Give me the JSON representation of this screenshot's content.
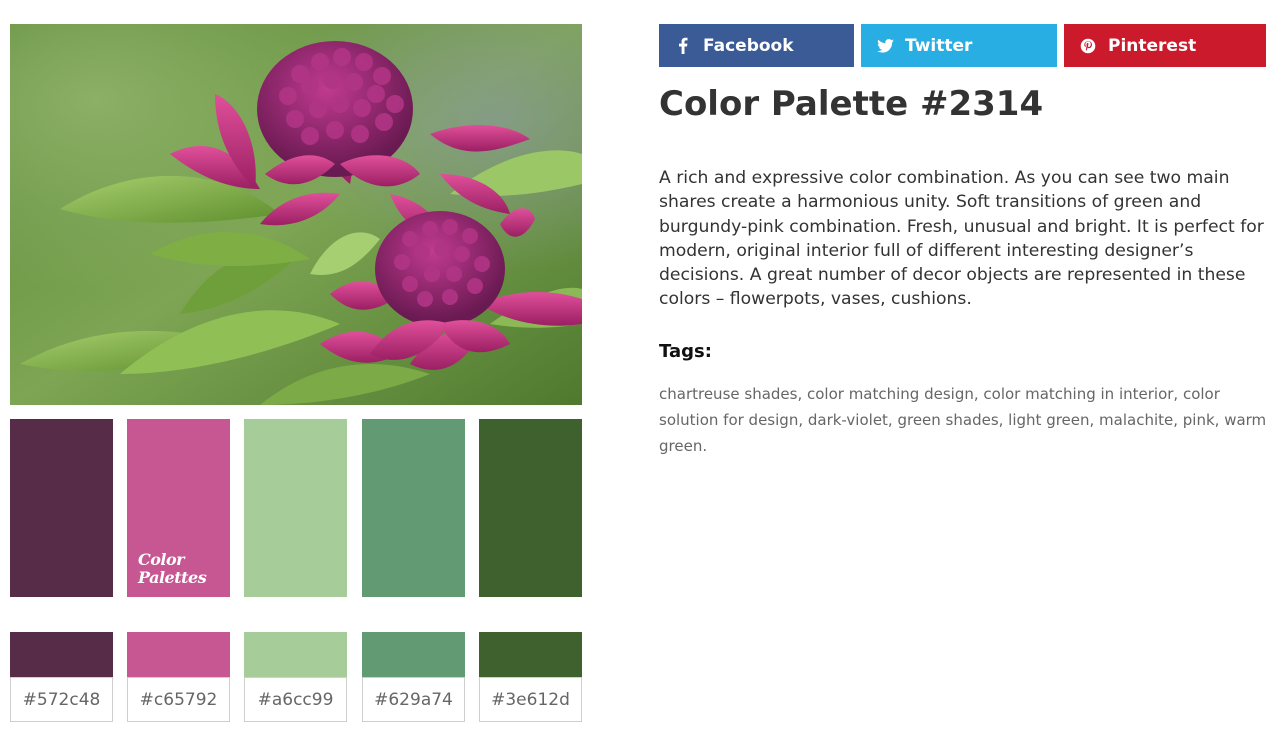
{
  "share": {
    "facebook": {
      "label": "Facebook",
      "color": "#3b5b97",
      "icon": "facebook-icon"
    },
    "twitter": {
      "label": "Twitter",
      "color": "#29aee3",
      "icon": "twitter-icon"
    },
    "pinterest": {
      "label": "Pinterest",
      "color": "#cb1a2c",
      "icon": "pinterest-icon"
    }
  },
  "page": {
    "title": "Color Palette #2314",
    "description": "A rich and expressive color combination. As you can see two main shares create a harmonious unity. Soft transitions of green and burgundy-pink combination. Fresh, unusual and bright. It is perfect for modern, original interior full of different interesting designer’s decisions. A great number of decor objects are represented in these colors – flowerpots, vases, cushions.",
    "tags_label": "Tags:",
    "tags": "chartreuse shades, color matching design, color matching in interior, color solution for design, dark-violet, green shades, light green, malachite, pink, warm green."
  },
  "palette": {
    "watermark_line1": "Color",
    "watermark_line2": "Palettes",
    "colors": [
      "#572c48",
      "#c65792",
      "#a6cc99",
      "#629a74",
      "#3e612d"
    ],
    "hex_labels": [
      "#572c48",
      "#c65792",
      "#a6cc99",
      "#629a74",
      "#3e612d"
    ]
  }
}
